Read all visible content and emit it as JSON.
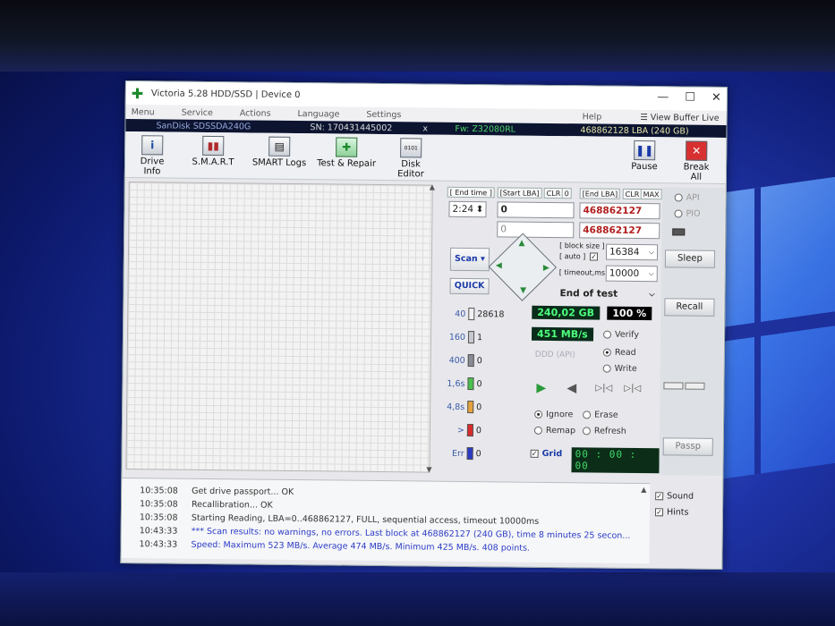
{
  "window": {
    "title": "Victoria 5.28 HDD/SSD | Device 0",
    "controls": [
      "—",
      "☐",
      "✕"
    ]
  },
  "menu": {
    "items": [
      "Menu",
      "Service",
      "Actions",
      "Language",
      "Settings"
    ],
    "help": "Help",
    "view_buffer": "View Buffer Live"
  },
  "device": {
    "model": "SanDisk SDSSDA240G",
    "serial": "SN: 170431445002",
    "x": "x",
    "firmware": "Fw: Z32080RL",
    "capacity": "468862128 LBA (240 GB)"
  },
  "toolbar": {
    "drive_info": "Drive Info",
    "smart": "S.M.A.R.T",
    "smart_logs": "SMART Logs",
    "test_repair": "Test & Repair",
    "disk_editor": "Disk Editor",
    "pause": "Pause",
    "break_all": "Break All"
  },
  "scan": {
    "end_time_label": "[ End time ]",
    "end_time": "2:24",
    "start_lba_label": "[Start LBA]",
    "clr": "CLR",
    "zero": "0",
    "start_lba": "0",
    "start_lba2": "0",
    "end_lba_label": "[End LBA]",
    "clr2": "CLR",
    "max": "MAX",
    "end_lba": "468862127",
    "end_lba2": "468862127",
    "block_size_label": "[ block size ]",
    "auto_label": "[ auto ]",
    "block_size": "16384",
    "timeout_label": "[ timeout,ms ]",
    "timeout": "10000",
    "scan_button": "Scan",
    "quick_button": "QUICK",
    "end_mode": "End of test"
  },
  "stats": {
    "rows": [
      {
        "label": "40",
        "count": "28618",
        "color": "#f2f2f2"
      },
      {
        "label": "160",
        "count": "1",
        "color": "#c8c8d0"
      },
      {
        "label": "400",
        "count": "0",
        "color": "#8a8a96"
      },
      {
        "label": "1,6s",
        "count": "0",
        "color": "#49c24c"
      },
      {
        "label": "4,8s",
        "count": "0",
        "color": "#e6a23c"
      },
      {
        "label": ">",
        "count": "0",
        "color": "#d92b2b"
      },
      {
        "label": "Err",
        "count": "0",
        "color": "#2a3ac6"
      }
    ],
    "size": "240,02 GB",
    "percent": "100",
    "percent_sign": "%",
    "speed": "451 MB/s",
    "ddd": "DDD (API)"
  },
  "modes": {
    "verify": "Verify",
    "read": "Read",
    "write": "Write",
    "ignore": "Ignore",
    "erase": "Erase",
    "remap": "Remap",
    "refresh": "Refresh",
    "grid": "Grid",
    "timer": "00 : 00 : 00"
  },
  "right": {
    "api": "API",
    "pio": "PIO",
    "sleep": "Sleep",
    "recall": "Recall",
    "passp": "Passp",
    "sound": "Sound",
    "hints": "Hints"
  },
  "log": [
    {
      "time": "10:35:08",
      "msg": "Get drive passport... OK",
      "blue": false
    },
    {
      "time": "10:35:08",
      "msg": "Recallibration... OK",
      "blue": false
    },
    {
      "time": "10:35:08",
      "msg": "Starting Reading, LBA=0..468862127, FULL, sequential access, timeout 10000ms",
      "blue": false
    },
    {
      "time": "10:43:33",
      "msg": "*** Scan results: no warnings, no errors. Last block at 468862127 (240 GB), time 8 minutes 25 secon...",
      "blue": true
    },
    {
      "time": "10:43:33",
      "msg": "Speed: Maximum 523 MB/s. Average 474 MB/s. Minimum 425 MB/s. 408 points.",
      "blue": true
    }
  ]
}
